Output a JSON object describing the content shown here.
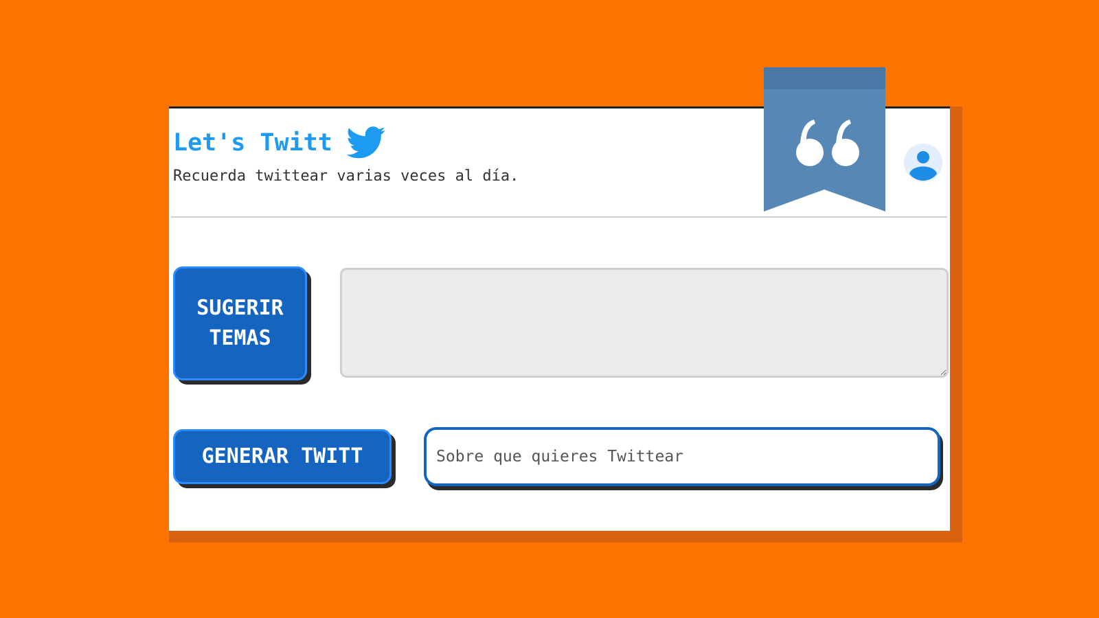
{
  "header": {
    "title": "Let's Twitt",
    "bird_icon": "twitter-bird-icon",
    "subtitle": "Recuerda twittear varias veces al día.",
    "avatar_icon": "user-avatar-icon"
  },
  "topics": {
    "suggest_label_line1": "SUGERIR",
    "suggest_label_line2": "TEMAS",
    "textarea_value": ""
  },
  "generate": {
    "button_label": "GENERAR TWITT",
    "input_placeholder": "Sobre que quieres Twittear",
    "input_value": ""
  },
  "overlay": {
    "bookmark_icon": "quote-bookmark-icon"
  },
  "colors": {
    "background": "#ff7300",
    "brand_blue": "#1d9bf0",
    "button_blue": "#1565c0",
    "bookmark_blue": "#5687b5"
  }
}
